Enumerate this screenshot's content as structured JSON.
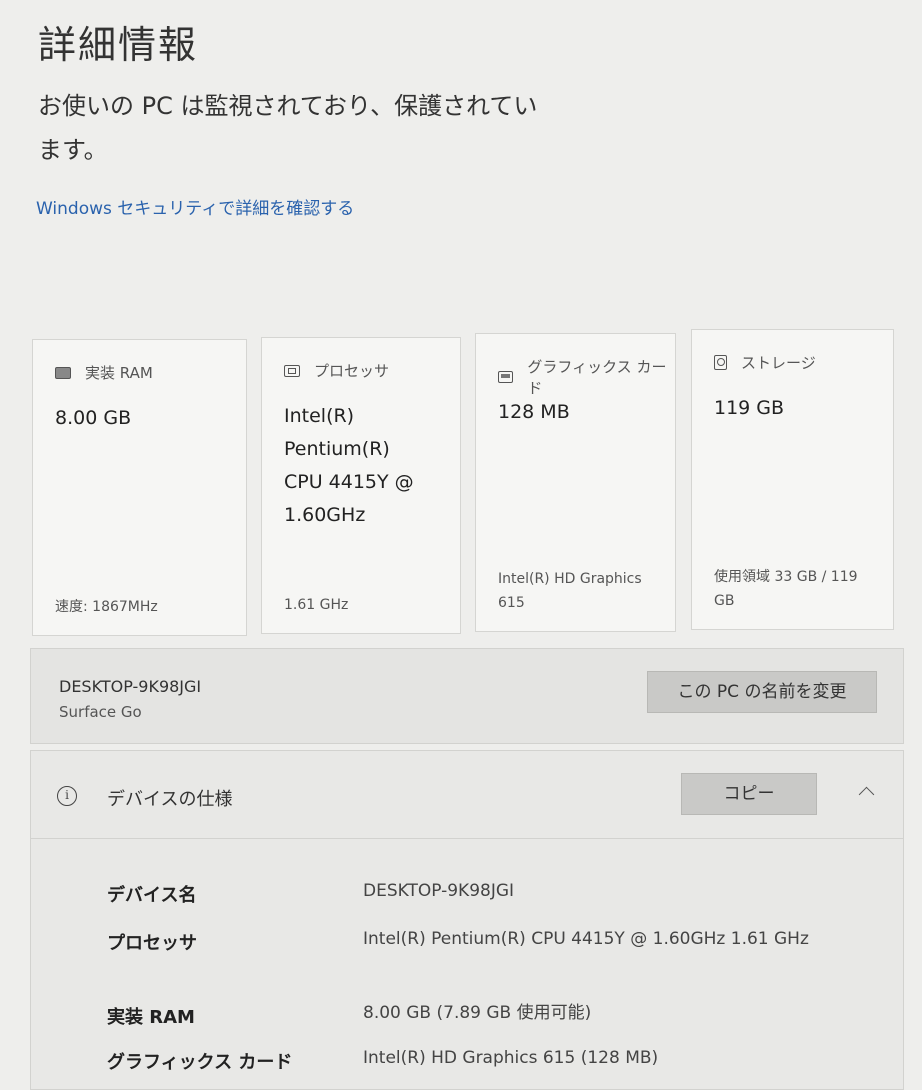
{
  "page": {
    "title": "詳細情報",
    "status": "お使いの PC は監視されており、保護されています。",
    "security_link": "Windows セキュリティで詳細を確認する"
  },
  "cards": [
    {
      "icon": "ram-icon",
      "label": "実装 RAM",
      "value": "8.00 GB",
      "footer": "速度: 1867MHz"
    },
    {
      "icon": "processor-icon",
      "label": "プロセッサ",
      "value": "Intel(R) Pentium(R) CPU 4415Y @ 1.60GHz",
      "footer": "1.61 GHz"
    },
    {
      "icon": "graphics-card-icon",
      "label": "グラフィックス カード",
      "value": "128 MB",
      "footer": "Intel(R) HD Graphics 615"
    },
    {
      "icon": "storage-icon",
      "label": "ストレージ",
      "value": "119 GB",
      "footer": "使用領域 33 GB / 119 GB"
    }
  ],
  "device": {
    "name": "DESKTOP-9K98JGI",
    "model": "Surface Go",
    "rename_label": "この PC の名前を変更"
  },
  "specs": {
    "title": "デバイスの仕様",
    "copy_label": "コピー",
    "rows": [
      {
        "label": "デバイス名",
        "value": "DESKTOP-9K98JGI"
      },
      {
        "label": "プロセッサ",
        "value": "Intel(R) Pentium(R) CPU 4415Y @ 1.60GHz   1.61 GHz"
      },
      {
        "label": "実装 RAM",
        "value": "8.00 GB (7.89 GB 使用可能)"
      },
      {
        "label": "グラフィックス カード",
        "value": "Intel(R) HD Graphics 615 (128 MB)"
      }
    ]
  }
}
